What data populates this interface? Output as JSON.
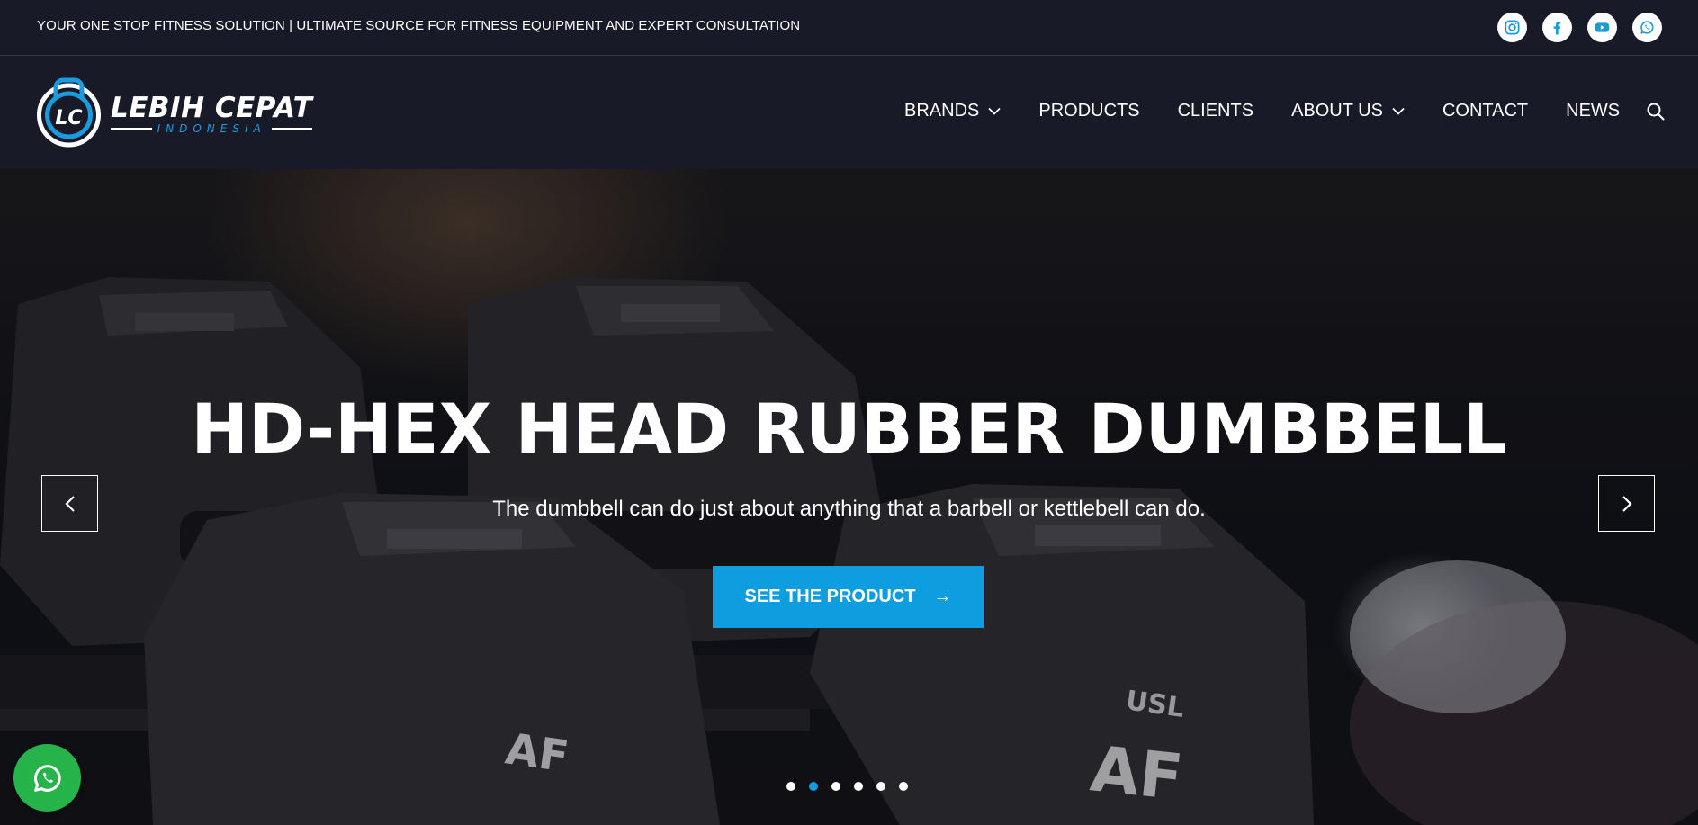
{
  "topbar": {
    "tagline": "YOUR ONE STOP FITNESS SOLUTION | ULTIMATE SOURCE FOR FITNESS EQUIPMENT AND EXPERT CONSULTATION",
    "socials": [
      "instagram-icon",
      "facebook-icon",
      "youtube-icon",
      "whatsapp-icon"
    ]
  },
  "logo": {
    "name": "LEBIH CEPAT",
    "sub": "INDONESIA"
  },
  "nav": {
    "items": [
      {
        "label": "BRANDS",
        "dropdown": true
      },
      {
        "label": "PRODUCTS",
        "dropdown": false
      },
      {
        "label": "CLIENTS",
        "dropdown": false
      },
      {
        "label": "ABOUT US",
        "dropdown": true
      },
      {
        "label": "CONTACT",
        "dropdown": false
      },
      {
        "label": "NEWS",
        "dropdown": false
      }
    ],
    "search_icon": "search-icon"
  },
  "hero": {
    "title": "HD-HEX HEAD RUBBER DUMBBELL",
    "subtitle": "The dumbbell can do just about anything that a barbell or kettlebell can do.",
    "cta_label": "SEE THE PRODUCT",
    "cta_arrow": "→",
    "slide_count": 6,
    "active_slide": 2
  },
  "colors": {
    "background": "#191a27",
    "accent": "#0e9ee0",
    "whatsapp": "#25b34a"
  }
}
